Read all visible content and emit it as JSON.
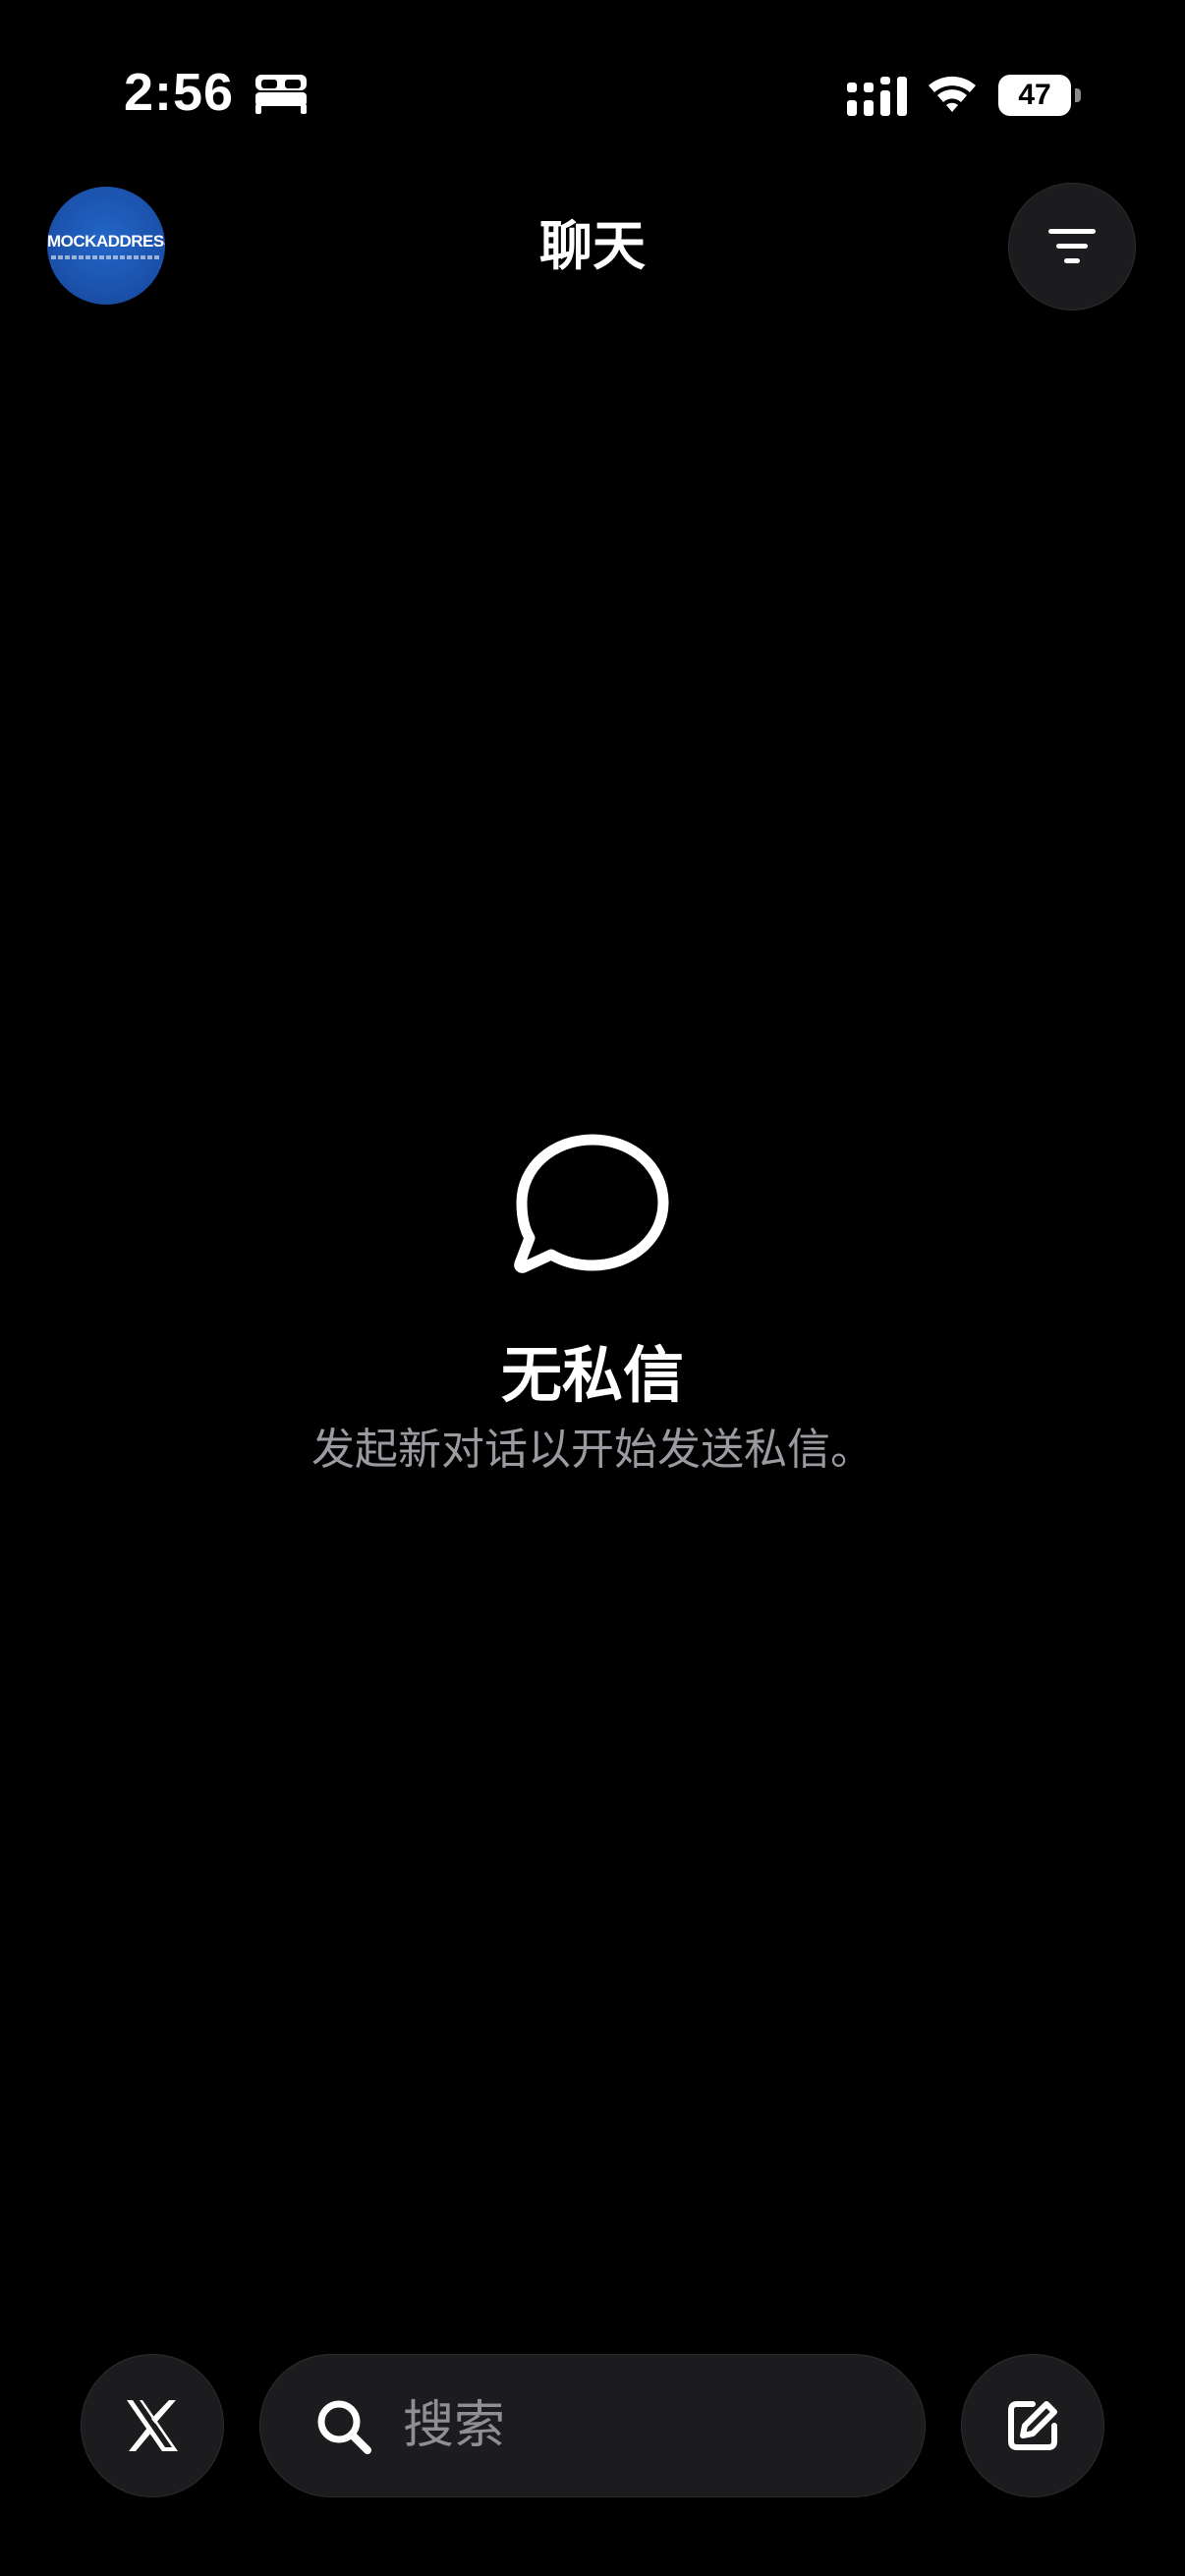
{
  "status_bar": {
    "time": "2:56",
    "battery_level": "47",
    "icons": [
      "bed-icon",
      "cellular-signal-icon",
      "wifi-icon",
      "battery-icon"
    ]
  },
  "header": {
    "title": "聊天",
    "avatar_text": "MOCKADDRESS",
    "filter_icon": "filter-icon"
  },
  "empty_state": {
    "icon": "chat-bubble-icon",
    "title": "无私信",
    "subtitle": "发起新对话以开始发送私信。"
  },
  "bottom_bar": {
    "home_icon": "x-logo-icon",
    "search_placeholder": "搜索",
    "compose_icon": "compose-icon"
  },
  "colors": {
    "background": "#000000",
    "text_primary": "#ffffff",
    "text_secondary": "#9a9aa0",
    "control_fill": "#1c1c1e",
    "avatar_blue": "#1a4fa8"
  }
}
